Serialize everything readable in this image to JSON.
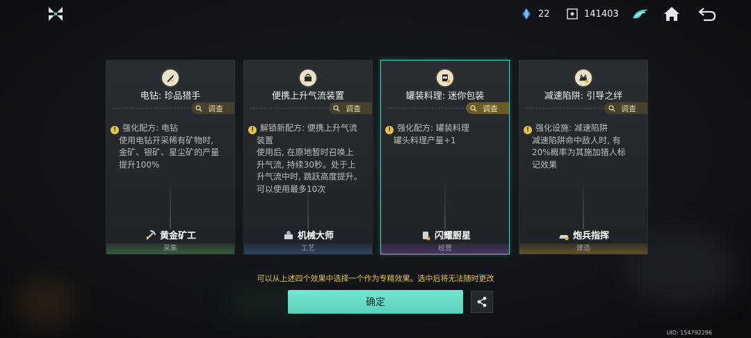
{
  "topbar": {
    "resource1_value": "22",
    "resource2_value": "141403",
    "icons": [
      "logo-icon",
      "crystal-icon",
      "coin-icon",
      "mount-icon",
      "home-icon",
      "back-icon"
    ]
  },
  "cards": [
    {
      "title": "电钻: 珍品猎手",
      "investigate": "调查",
      "lines": [
        "强化配方: 电钻",
        "使用电钻开采稀有矿物时,",
        "金矿、银矿、星尘矿的产量",
        "提升100%"
      ],
      "badge": "黄金矿工",
      "category": "采集"
    },
    {
      "title": "便携上升气流装置",
      "investigate": "调查",
      "lines": [
        "解锁新配方: 便携上升气流",
        "装置",
        "使用后, 在原地暂时召唤上",
        "升气流, 持续30秒。处于上",
        "升气流中时, 跳跃高度提升。",
        "可以使用最多10次"
      ],
      "badge": "机械大师",
      "category": "工艺"
    },
    {
      "title": "罐装料理: 迷你包装",
      "investigate": "调查",
      "lines": [
        "强化配方: 罐装料理",
        "罐头料理产量+1"
      ],
      "badge": "闪耀厨星",
      "category": "经营"
    },
    {
      "title": "减速陷阱: 引导之绊",
      "investigate": "调查",
      "lines": [
        "强化设施: 减速陷阱",
        "减速陷阱命中敌人时, 有",
        "20%概率为其施加猎人标",
        "记效果"
      ],
      "badge": "炮兵指挥",
      "category": "建造"
    }
  ],
  "notice": "可以从上述四个效果中选择一个作为专精效果。选中后将无法随时更改",
  "confirm_label": "确定",
  "uid": "UID: 154792296",
  "colors": {
    "accent": "#5ccfbc",
    "gold": "#e7c24b",
    "selected_border": "#3fd6c5"
  }
}
